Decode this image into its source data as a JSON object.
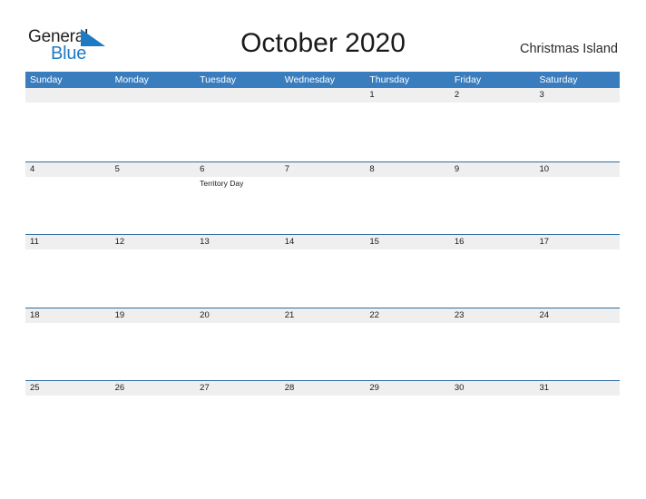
{
  "brand": {
    "name_part1": "General",
    "name_part2": "Blue",
    "mark": "triangle-logo-icon",
    "color_primary": "#1f7ac4",
    "color_text": "#231f20"
  },
  "header": {
    "title": "October 2020",
    "region": "Christmas Island"
  },
  "calendar": {
    "header_bg": "#3a7dbf",
    "band_bg": "#efefef",
    "band_border": "#2f6da3",
    "day_names": [
      "Sunday",
      "Monday",
      "Tuesday",
      "Wednesday",
      "Thursday",
      "Friday",
      "Saturday"
    ],
    "weeks": [
      {
        "days": [
          {
            "num": "",
            "events": []
          },
          {
            "num": "",
            "events": []
          },
          {
            "num": "",
            "events": []
          },
          {
            "num": "",
            "events": []
          },
          {
            "num": "1",
            "events": []
          },
          {
            "num": "2",
            "events": []
          },
          {
            "num": "3",
            "events": []
          }
        ]
      },
      {
        "days": [
          {
            "num": "4",
            "events": []
          },
          {
            "num": "5",
            "events": []
          },
          {
            "num": "6",
            "events": [
              "Territory Day"
            ]
          },
          {
            "num": "7",
            "events": []
          },
          {
            "num": "8",
            "events": []
          },
          {
            "num": "9",
            "events": []
          },
          {
            "num": "10",
            "events": []
          }
        ]
      },
      {
        "days": [
          {
            "num": "11",
            "events": []
          },
          {
            "num": "12",
            "events": []
          },
          {
            "num": "13",
            "events": []
          },
          {
            "num": "14",
            "events": []
          },
          {
            "num": "15",
            "events": []
          },
          {
            "num": "16",
            "events": []
          },
          {
            "num": "17",
            "events": []
          }
        ]
      },
      {
        "days": [
          {
            "num": "18",
            "events": []
          },
          {
            "num": "19",
            "events": []
          },
          {
            "num": "20",
            "events": []
          },
          {
            "num": "21",
            "events": []
          },
          {
            "num": "22",
            "events": []
          },
          {
            "num": "23",
            "events": []
          },
          {
            "num": "24",
            "events": []
          }
        ]
      },
      {
        "days": [
          {
            "num": "25",
            "events": []
          },
          {
            "num": "26",
            "events": []
          },
          {
            "num": "27",
            "events": []
          },
          {
            "num": "28",
            "events": []
          },
          {
            "num": "29",
            "events": []
          },
          {
            "num": "30",
            "events": []
          },
          {
            "num": "31",
            "events": []
          }
        ]
      }
    ]
  }
}
